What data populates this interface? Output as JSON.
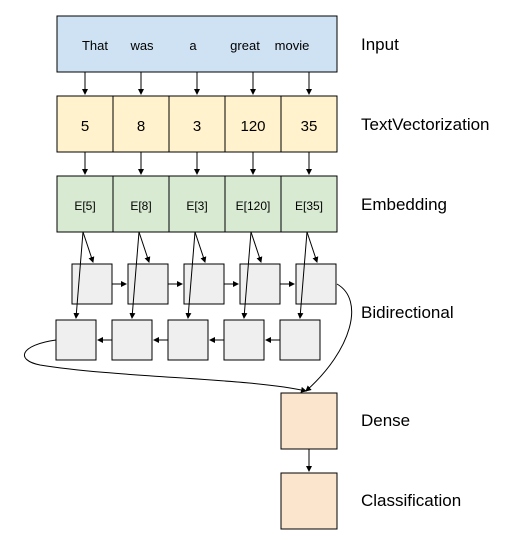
{
  "input": {
    "label": "Input",
    "words": [
      "That",
      "was",
      "a",
      "great",
      "movie"
    ]
  },
  "vectorization": {
    "label": "TextVectorization",
    "tokens": [
      "5",
      "8",
      "3",
      "120",
      "35"
    ]
  },
  "embedding": {
    "label": "Embedding",
    "vectors": [
      "E[5]",
      "E[8]",
      "E[3]",
      "E[120]",
      "E[35]"
    ]
  },
  "bidirectional": {
    "label": "Bidirectional"
  },
  "dense": {
    "label": "Dense"
  },
  "classification": {
    "label": "Classification"
  },
  "colors": {
    "input": "#cfe2f3",
    "vectorization": "#fff2cc",
    "embedding": "#d9ead3",
    "rnn": "#efefef",
    "dense": "#fce5cd"
  }
}
